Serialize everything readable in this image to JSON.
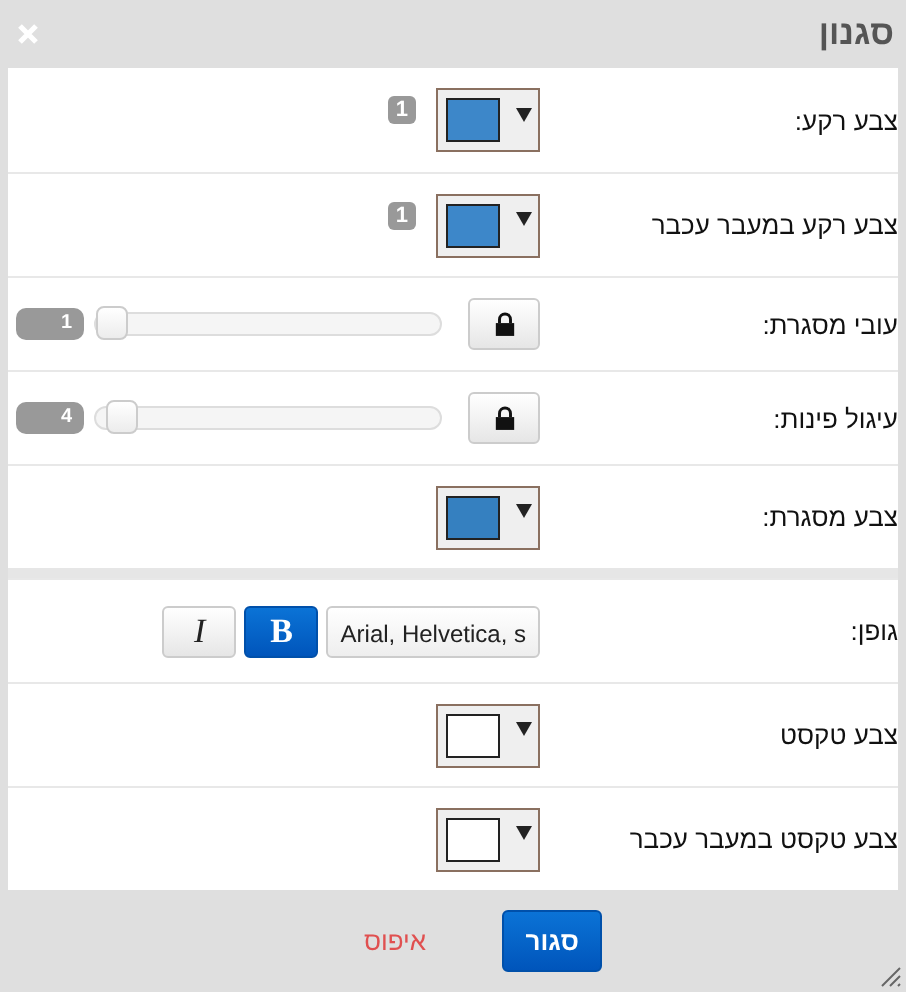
{
  "dialog": {
    "title": "סגנון"
  },
  "sections": [
    {
      "rows": [
        {
          "kind": "color",
          "label": "צבע רקע:",
          "color": "#3d87c9",
          "badge": "1"
        },
        {
          "kind": "color",
          "label": "צבע רקע במעבר עכבר",
          "color": "#3d87c9",
          "badge": "1"
        },
        {
          "kind": "slider",
          "label": "עובי מסגרת:",
          "level": 0,
          "value": "1"
        },
        {
          "kind": "slider",
          "label": "עיגול פינות:",
          "level": 0.03,
          "value": "4"
        },
        {
          "kind": "color",
          "label": "צבע מסגרת:",
          "color": "#3580c0"
        }
      ]
    },
    {
      "rows": [
        {
          "kind": "font",
          "label": "גופן:",
          "font": "Arial, Helvetica, s",
          "bold": {
            "label": "B",
            "selected": true
          },
          "italic": {
            "label": "I",
            "selected": false
          }
        },
        {
          "kind": "color",
          "label": "צבע טקסט",
          "color": "#ffffff"
        },
        {
          "kind": "color",
          "label": "צבע טקסט במעבר עכבר",
          "color": "#ffffff"
        }
      ]
    }
  ],
  "buttons": [
    {
      "kind": "primary",
      "label": "סגור"
    },
    {
      "kind": "link",
      "label": "איפוס"
    }
  ]
}
